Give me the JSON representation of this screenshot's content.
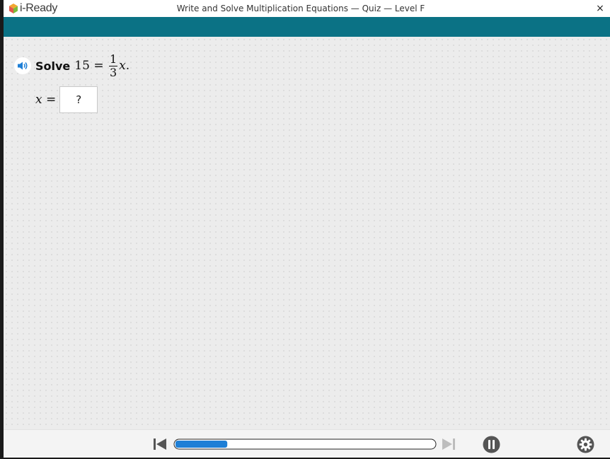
{
  "app": {
    "logo_text": "i-Ready"
  },
  "window": {
    "title": "Write and Solve Multiplication Equations — Quiz — Level F",
    "close_glyph": "×"
  },
  "question": {
    "instruction": "Solve",
    "lhs": "15",
    "equals": "=",
    "fraction_numerator": "1",
    "fraction_denominator": "3",
    "variable": "x",
    "period": "."
  },
  "answer": {
    "variable": "x",
    "equals": "=",
    "value": "?"
  },
  "toolbar": {
    "progress": 0.2
  },
  "colors": {
    "teal_bar": "#0b7285",
    "progress_fill": "#1e7fd6",
    "audio_icon": "#1e7fd6",
    "controls": "#555555",
    "disabled": "#bdbdbd"
  },
  "icons": {
    "audio": "speaker-icon",
    "prev": "skip-back-icon",
    "next": "skip-forward-icon",
    "pause": "pause-icon",
    "settings": "gear-icon"
  }
}
